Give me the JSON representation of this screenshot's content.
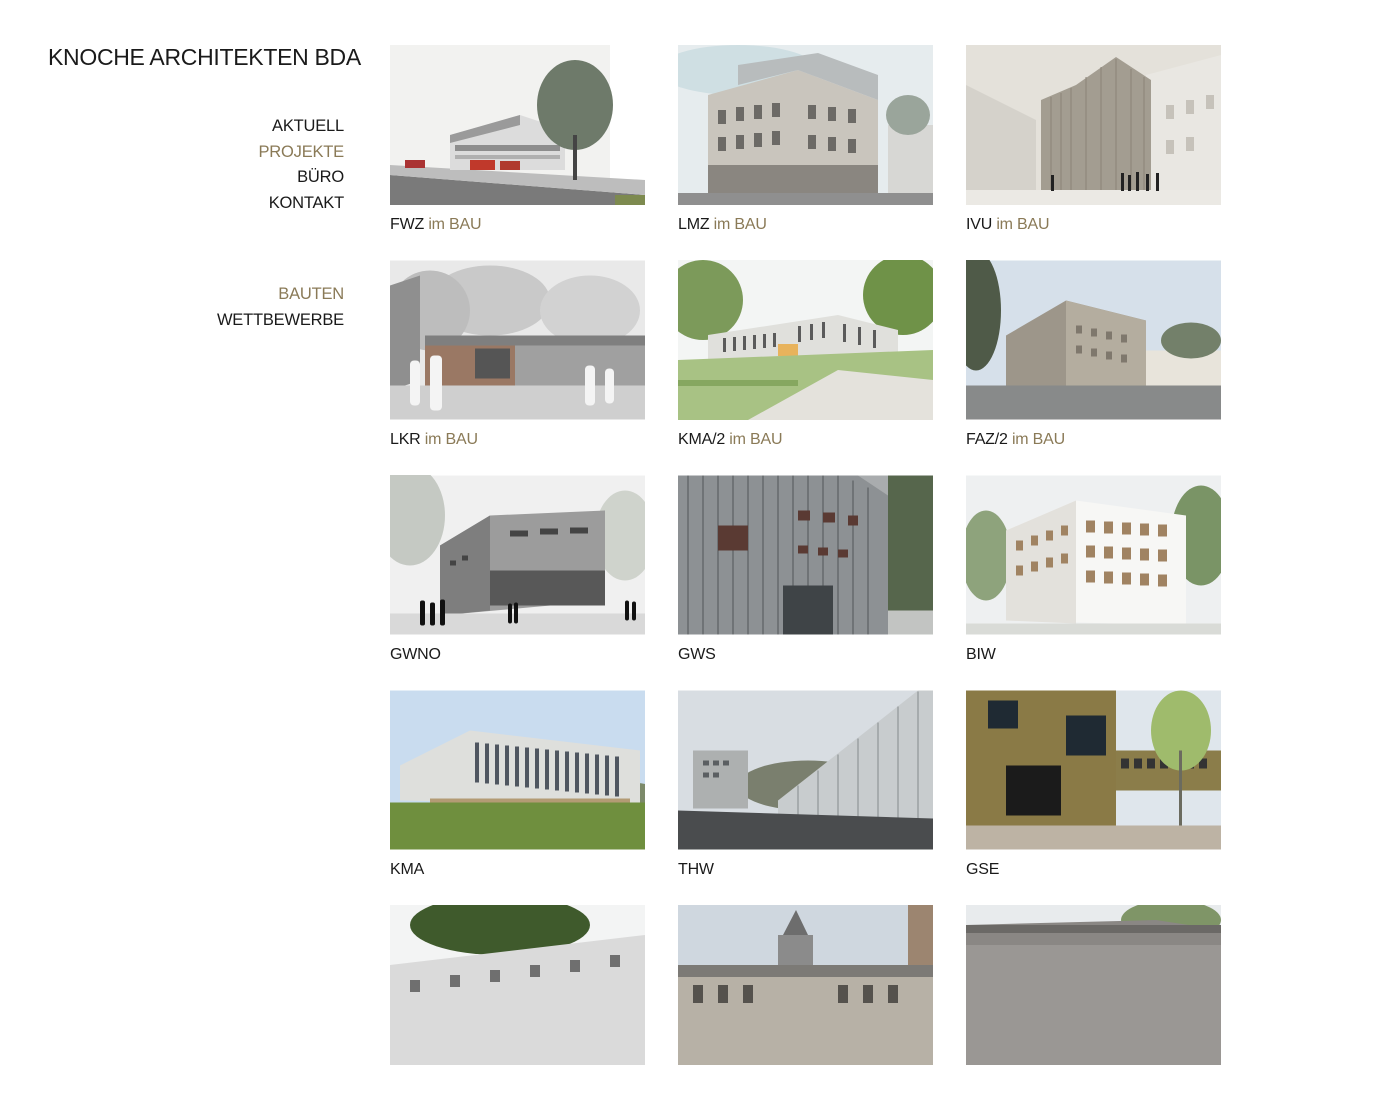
{
  "site": {
    "title": "KNOCHE ARCHITEKTEN BDA"
  },
  "nav": {
    "items": [
      {
        "label": "AKTUELL",
        "active": false
      },
      {
        "label": "PROJEKTE",
        "active": true
      },
      {
        "label": "BÜRO",
        "active": false
      },
      {
        "label": "KONTAKT",
        "active": false
      }
    ]
  },
  "subnav": {
    "items": [
      {
        "label": "BAUTEN",
        "active": true
      },
      {
        "label": "WETTBEWERBE",
        "active": false
      }
    ]
  },
  "colors": {
    "accent": "#8a7a57",
    "text": "#1a1a1a",
    "background": "#ffffff"
  },
  "projects": [
    {
      "code": "FWZ",
      "status": "im BAU",
      "image": "fwz-rendering"
    },
    {
      "code": "LMZ",
      "status": "im BAU",
      "image": "lmz-rendering"
    },
    {
      "code": "IVU",
      "status": "im BAU",
      "image": "ivu-rendering"
    },
    {
      "code": "LKR",
      "status": "im BAU",
      "image": "lkr-rendering"
    },
    {
      "code": "KMA/2",
      "status": "im BAU",
      "image": "kma2-rendering"
    },
    {
      "code": "FAZ/2",
      "status": "im BAU",
      "image": "faz2-rendering"
    },
    {
      "code": "GWNO",
      "status": "",
      "image": "gwno-rendering"
    },
    {
      "code": "GWS",
      "status": "",
      "image": "gws-photo"
    },
    {
      "code": "BIW",
      "status": "",
      "image": "biw-rendering"
    },
    {
      "code": "KMA",
      "status": "",
      "image": "kma-photo"
    },
    {
      "code": "THW",
      "status": "",
      "image": "thw-photo"
    },
    {
      "code": "GSE",
      "status": "",
      "image": "gse-photo"
    },
    {
      "code": "",
      "status": "",
      "image": "project-photo-13"
    },
    {
      "code": "",
      "status": "",
      "image": "project-photo-14"
    },
    {
      "code": "",
      "status": "",
      "image": "project-photo-15"
    }
  ]
}
